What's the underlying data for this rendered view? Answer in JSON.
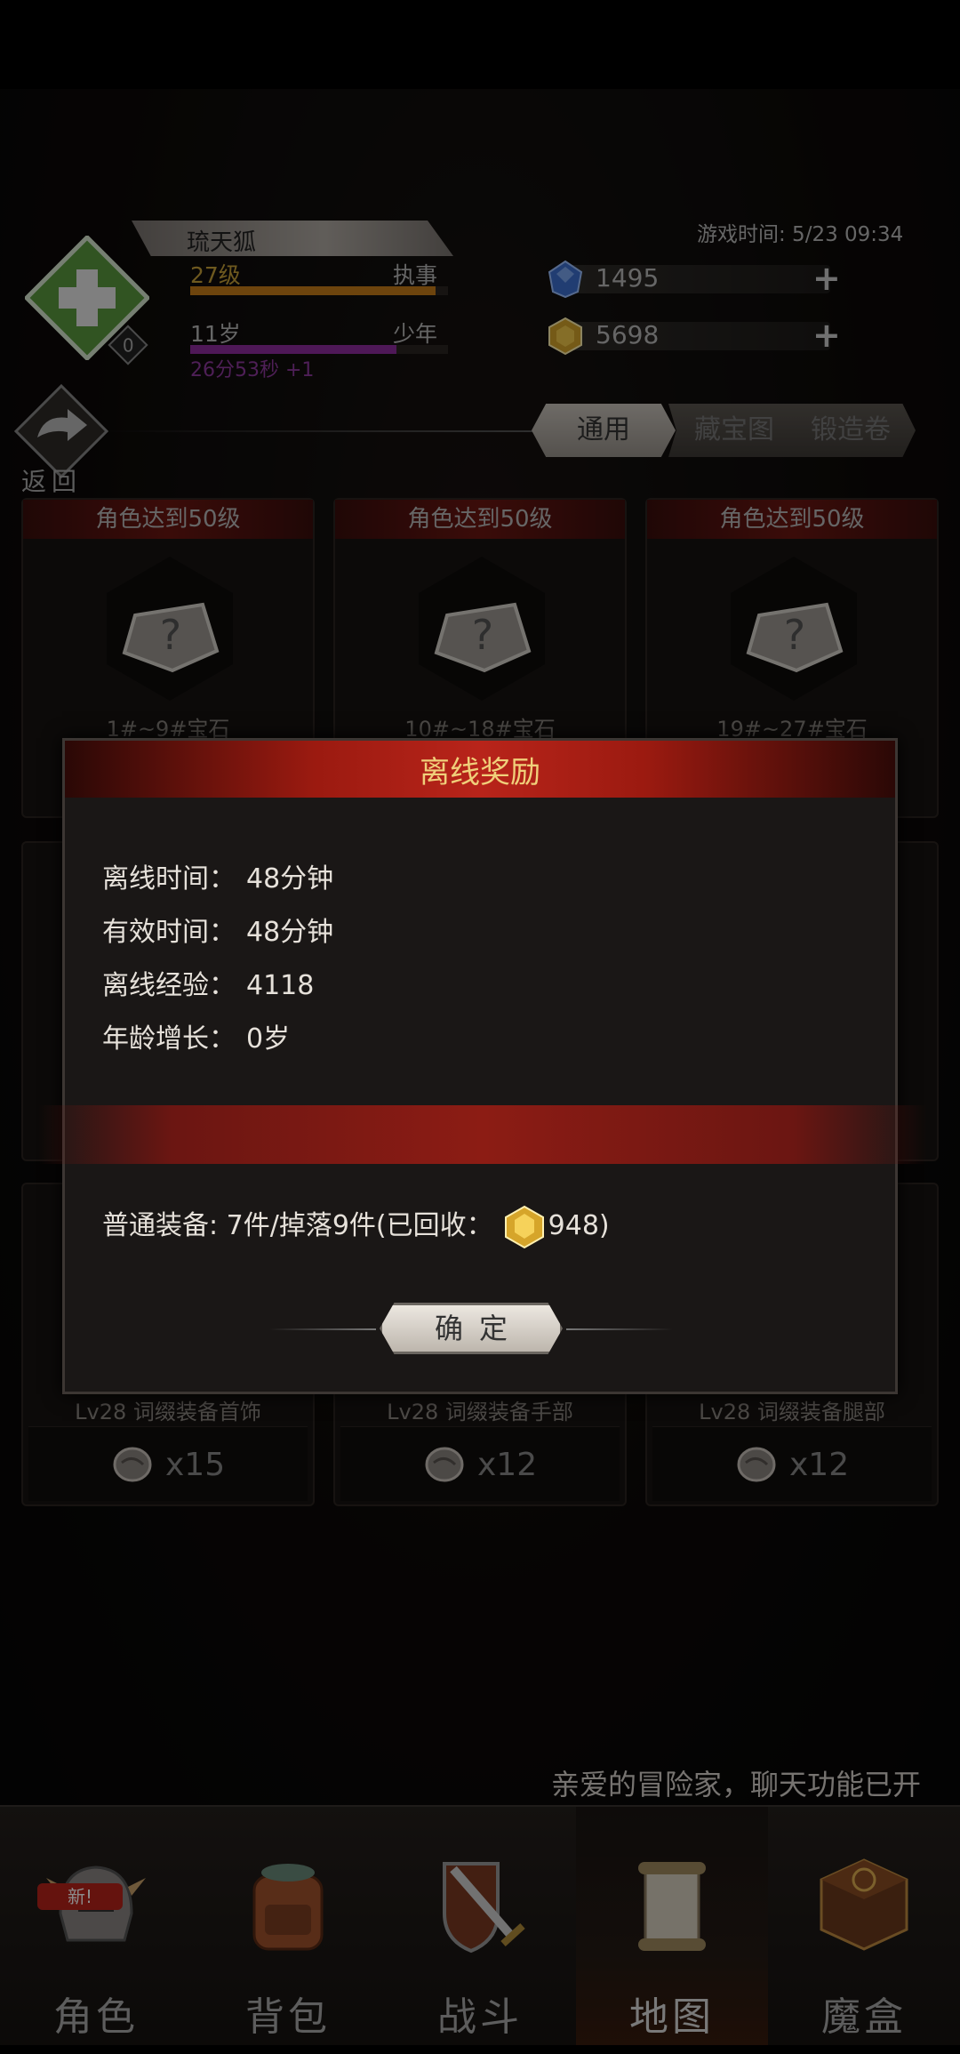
{
  "status": {
    "faded_text": ""
  },
  "player": {
    "name": "琉天狐",
    "level": "27级",
    "rank": "执事",
    "age": "11岁",
    "stage": "少年",
    "age_timer": "26分53秒 +1",
    "emblem_badge": "0",
    "exp_fraction": 0.95,
    "age_fraction": 0.8
  },
  "game_time": "游戏时间: 5/23 09:34",
  "currencies": [
    {
      "name": "blue-gem",
      "value": "1495",
      "color": "#3d6fd0"
    },
    {
      "name": "gold-gem",
      "value": "5698",
      "color": "#d6a52a"
    }
  ],
  "back_label": "返回",
  "tabs": [
    "通用",
    "藏宝图",
    "锻造卷"
  ],
  "cards": [
    {
      "title": "角色达到50级",
      "sub": "1#~9#宝石"
    },
    {
      "title": "角色达到50级",
      "sub": "10#~18#宝石"
    },
    {
      "title": "角色达到50级",
      "sub": "19#~27#宝石"
    },
    {
      "title": "",
      "sub": "Lv28 词缀装备首饰",
      "qty": "x15"
    },
    {
      "title": "",
      "sub": "Lv28 词缀装备手部",
      "qty": "x12"
    },
    {
      "title": "",
      "sub": "Lv28 词缀装备腿部",
      "qty": "x12"
    }
  ],
  "modal": {
    "title": "离线奖励",
    "rows": [
      {
        "k": "离线时间：",
        "v": "48分钟"
      },
      {
        "k": "有效时间：",
        "v": "48分钟"
      },
      {
        "k": "离线经验：",
        "v": "4118"
      },
      {
        "k": "年龄增长：",
        "v": "0岁"
      }
    ],
    "equip_text": "普通装备: 7件/掉落9件(已回收：",
    "equip_value": "948)",
    "confirm": "确定"
  },
  "chat_ticker": "亲爱的冒险家，聊天功能已开",
  "nav": [
    {
      "label": "角色",
      "badge": "新!"
    },
    {
      "label": "背包"
    },
    {
      "label": "战斗"
    },
    {
      "label": "地图"
    },
    {
      "label": "魔盒"
    }
  ],
  "colors": {
    "accent_red": "#b8241a",
    "gold_text": "#f0cf7a",
    "level_gold": "#c9a23a",
    "age_purple": "#8e3a9e"
  }
}
